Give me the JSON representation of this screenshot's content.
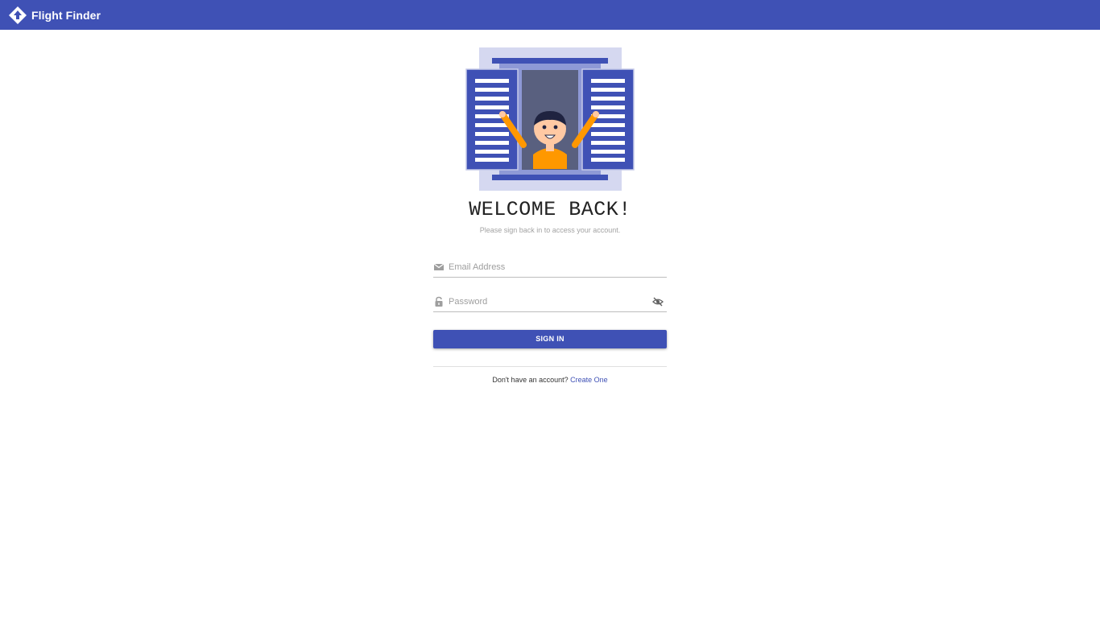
{
  "app": {
    "title": "Flight Finder",
    "logo_icon": "diamond-arrows-logo-icon",
    "brand_color": "#3f51b5"
  },
  "hero": {
    "illustration": "person-waving-at-window-illustration",
    "heading": "WELCOME BACK!",
    "subheading": "Please sign back in to access your account."
  },
  "form": {
    "email": {
      "icon": "envelope-icon",
      "placeholder": "Email Address",
      "value": ""
    },
    "password": {
      "icon": "lock-icon",
      "placeholder": "Password",
      "value": "",
      "toggle_icon": "eye-off-icon"
    },
    "submit_label": "SIGN IN"
  },
  "footer": {
    "prompt": "Don't have an account?",
    "link_label": "Create One"
  }
}
